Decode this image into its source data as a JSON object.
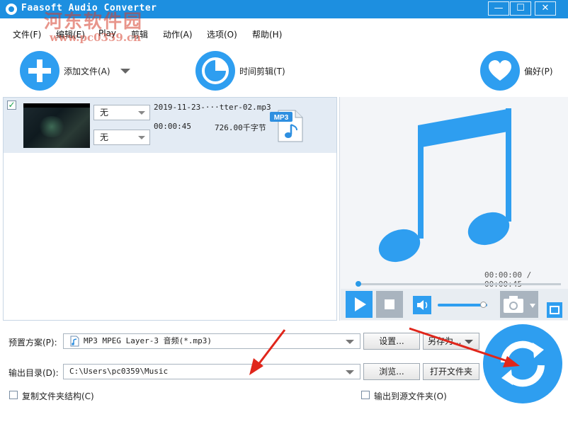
{
  "window": {
    "title": "Faasoft Audio Converter",
    "minimize_glyph": "—",
    "maximize_glyph": "☐",
    "close_glyph": "✕"
  },
  "watermark": {
    "main": "河东软件园",
    "url": "www.pc0359.cn"
  },
  "menu": {
    "items": [
      "文件(F)",
      "编辑(E)",
      "Play",
      "剪辑",
      "动作(A)",
      "选项(O)",
      "帮助(H)"
    ]
  },
  "toolbar": {
    "add_file_label": "添加文件(A)",
    "add_file_icon": "plus-icon",
    "trim_label": "时间剪辑(T)",
    "trim_icon": "pie-clock-icon",
    "prefs_label": "偏好(P)",
    "prefs_icon": "heart-icon"
  },
  "file_list": {
    "items": [
      {
        "checked": true,
        "filename": "2019-11-23-···tter-02.mp3",
        "duration": "00:00:45",
        "size": "726.00千字节",
        "audio_track": "无",
        "subtitle": "无",
        "format_badge": "MP3"
      }
    ]
  },
  "preview": {
    "current_time": "00:00:00",
    "separator": " / ",
    "total_time": "00:00:45",
    "volume_percent": 93,
    "progress_percent": 0
  },
  "settings": {
    "preset_label": "预置方案(P):",
    "preset_value": "MP3 MPEG Layer-3 音频(*.mp3)",
    "settings_button": "设置...",
    "save_as_button": "另存为...",
    "output_label": "输出目录(D):",
    "output_value": "C:\\Users\\pc0359\\Music",
    "browse_button": "浏览...",
    "open_folder_button": "打开文件夹",
    "copy_structure_label": "复制文件夹结构(C)",
    "output_to_source_label": "输出到源文件夹(O)"
  },
  "colors": {
    "accent": "#2e9ef0",
    "titlebar": "#1d8fe0",
    "arrow": "#e0261b"
  }
}
